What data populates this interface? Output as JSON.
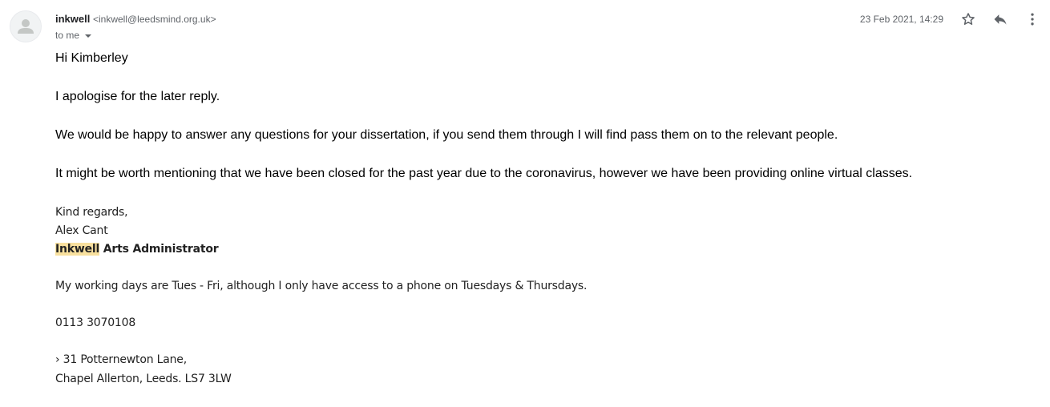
{
  "header": {
    "sender_name": "inkwell",
    "sender_email": "<inkwell@leedsmind.org.uk>",
    "to_label": "to me",
    "date": "23 Feb 2021, 14:29",
    "icons": {
      "avatar": "person-avatar-icon",
      "star": "star-icon",
      "reply": "reply-icon",
      "more": "more-vertical-icon"
    }
  },
  "message": {
    "greeting": "Hi Kimberley",
    "para1": "I apologise for the later reply.",
    "para2": "We would be happy to answer any questions for your dissertation, if you send them through I will find pass them on to the relevant people.",
    "para3": "It might be worth mentioning that we have been closed for the past year due to the coronavirus, however we have been providing online virtual classes."
  },
  "signature": {
    "closing": "Kind regards,",
    "name": "Alex Cant",
    "org_highlight": "Inkwell",
    "title_rest": " Arts Administrator",
    "working_days": "My working days are Tues - Fri, although I only have access to a phone on Tuesdays & Thursdays.",
    "phone": "0113 3070108",
    "address_line1": "› 31 Potternewton Lane,",
    "address_line2": "Chapel Allerton, Leeds. LS7 3LW"
  },
  "colors": {
    "highlight": "#f8e09e",
    "secondary_text": "#5f6368"
  }
}
